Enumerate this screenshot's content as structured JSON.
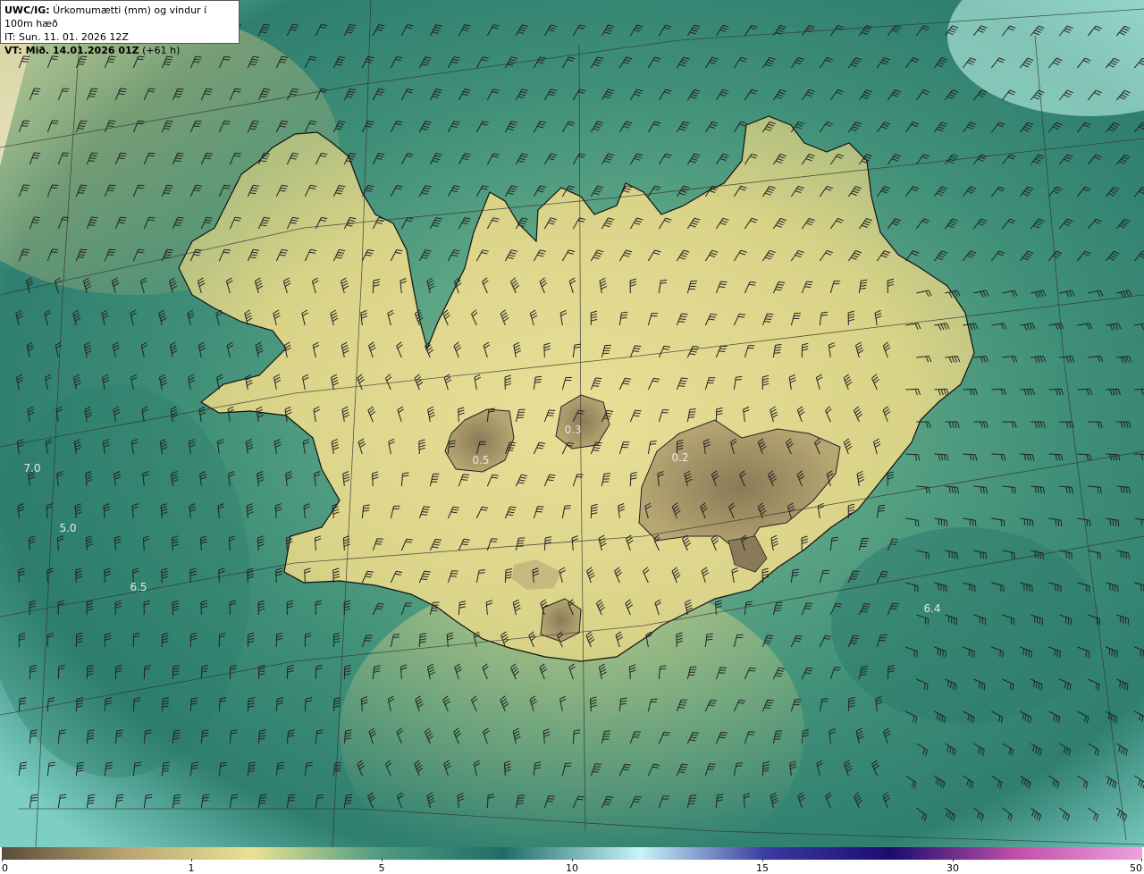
{
  "header": {
    "line1_bold": "UWC/IG:",
    "line1_rest": " Úrkomumætti (mm) og vindur í 100m hæð",
    "line2": "IT: Sun. 11. 01. 2026 12Z",
    "line3_bold": "VT: Mið. 14.01.2026 01Z",
    "line3_rest": " (+61 h)"
  },
  "value_labels": [
    {
      "text": "7.0"
    },
    {
      "text": "5.0"
    },
    {
      "text": "6.5"
    },
    {
      "text": "0.3"
    },
    {
      "text": "0.2"
    },
    {
      "text": "0.5"
    },
    {
      "text": "6.4"
    }
  ],
  "colorbar": {
    "ticks": [
      "0",
      "1",
      "5",
      "10",
      "15",
      "30",
      "50"
    ],
    "colors": [
      "#5a4d3a",
      "#b8a672",
      "#e9e294",
      "#4f9c82",
      "#1f6d66",
      "#c8f4f8",
      "#3a3aa0",
      "#1c0c70",
      "#c050a8",
      "#f0a0e0"
    ]
  },
  "colors": {
    "land_dry": "#b59d6e",
    "land_mid": "#e3d98e",
    "sea_green": "#4d9a80",
    "sea_dark": "#2e7b6e",
    "sea_light": "#9edbcd",
    "coast_line": "#111111",
    "barb": "#222222"
  }
}
